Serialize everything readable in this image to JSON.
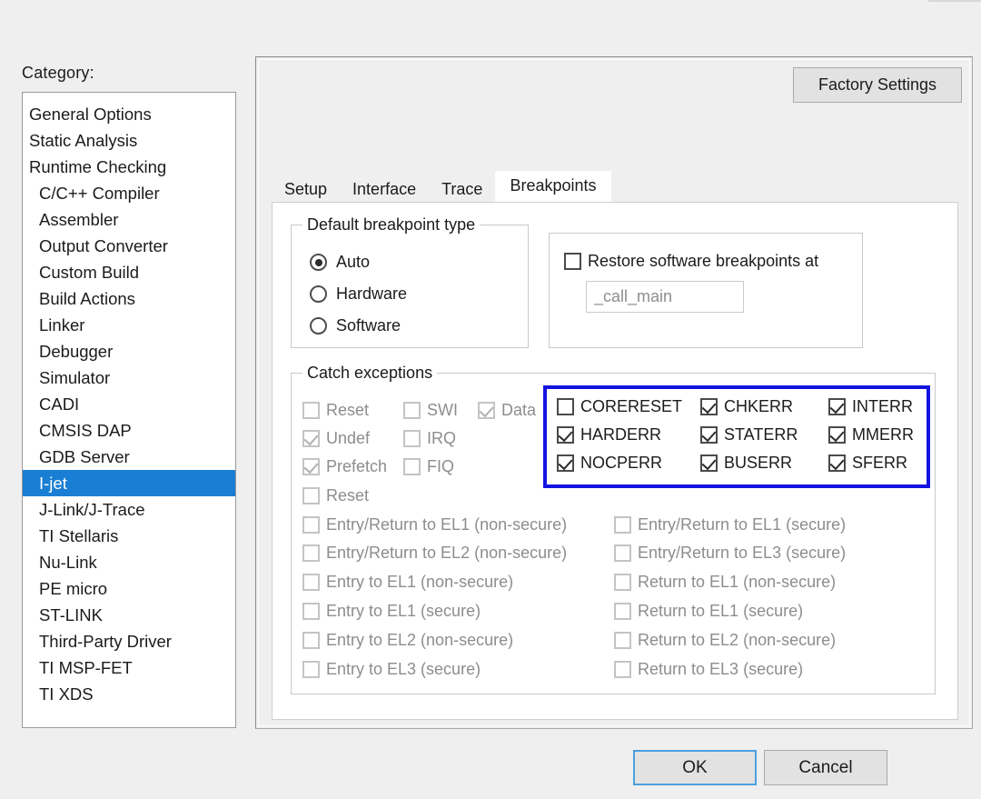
{
  "category": {
    "label": "Category:",
    "items": [
      {
        "label": "General Options",
        "indent": false,
        "selected": false
      },
      {
        "label": "Static Analysis",
        "indent": false,
        "selected": false
      },
      {
        "label": "Runtime Checking",
        "indent": false,
        "selected": false
      },
      {
        "label": "C/C++ Compiler",
        "indent": true,
        "selected": false
      },
      {
        "label": "Assembler",
        "indent": true,
        "selected": false
      },
      {
        "label": "Output Converter",
        "indent": true,
        "selected": false
      },
      {
        "label": "Custom Build",
        "indent": true,
        "selected": false
      },
      {
        "label": "Build Actions",
        "indent": true,
        "selected": false
      },
      {
        "label": "Linker",
        "indent": true,
        "selected": false
      },
      {
        "label": "Debugger",
        "indent": true,
        "selected": false
      },
      {
        "label": "Simulator",
        "indent": true,
        "selected": false
      },
      {
        "label": "CADI",
        "indent": true,
        "selected": false
      },
      {
        "label": "CMSIS DAP",
        "indent": true,
        "selected": false
      },
      {
        "label": "GDB Server",
        "indent": true,
        "selected": false
      },
      {
        "label": "I-jet",
        "indent": true,
        "selected": true
      },
      {
        "label": "J-Link/J-Trace",
        "indent": true,
        "selected": false
      },
      {
        "label": "TI Stellaris",
        "indent": true,
        "selected": false
      },
      {
        "label": "Nu-Link",
        "indent": true,
        "selected": false
      },
      {
        "label": "PE micro",
        "indent": true,
        "selected": false
      },
      {
        "label": "ST-LINK",
        "indent": true,
        "selected": false
      },
      {
        "label": "Third-Party Driver",
        "indent": true,
        "selected": false
      },
      {
        "label": "TI MSP-FET",
        "indent": true,
        "selected": false
      },
      {
        "label": "TI XDS",
        "indent": true,
        "selected": false
      }
    ]
  },
  "factory_settings_label": "Factory Settings",
  "tabs": [
    {
      "label": "Setup",
      "selected": false
    },
    {
      "label": "Interface",
      "selected": false
    },
    {
      "label": "Trace",
      "selected": false
    },
    {
      "label": "Breakpoints",
      "selected": true
    }
  ],
  "default_breakpoint_type": {
    "title": "Default breakpoint type",
    "options": [
      {
        "label": "Auto",
        "checked": true
      },
      {
        "label": "Hardware",
        "checked": false
      },
      {
        "label": "Software",
        "checked": false
      }
    ]
  },
  "restore": {
    "checkbox_label": "Restore software breakpoints at",
    "checked": false,
    "input_value": "_call_main",
    "input_placeholder": "_call_main"
  },
  "catch_exceptions": {
    "title": "Catch exceptions",
    "col1": [
      {
        "label": "Reset",
        "checked": false,
        "disabled": true
      },
      {
        "label": "Undef",
        "checked": true,
        "disabled": true
      },
      {
        "label": "Prefetch",
        "checked": true,
        "disabled": true
      }
    ],
    "col2": [
      {
        "label": "SWI",
        "checked": false,
        "disabled": true
      },
      {
        "label": "IRQ",
        "checked": false,
        "disabled": true
      },
      {
        "label": "FIQ",
        "checked": false,
        "disabled": true
      }
    ],
    "col3": [
      {
        "label": "Data",
        "checked": true,
        "disabled": true
      }
    ],
    "highlighted": {
      "border_color": "#1414E0",
      "rows": [
        [
          {
            "label": "CORERESET",
            "checked": false,
            "disabled": false
          },
          {
            "label": "CHKERR",
            "checked": true,
            "disabled": false
          },
          {
            "label": "INTERR",
            "checked": true,
            "disabled": false
          }
        ],
        [
          {
            "label": "HARDERR",
            "checked": true,
            "disabled": false
          },
          {
            "label": "STATERR",
            "checked": true,
            "disabled": false
          },
          {
            "label": "MMERR",
            "checked": true,
            "disabled": false
          }
        ],
        [
          {
            "label": "NOCPERR",
            "checked": true,
            "disabled": false
          },
          {
            "label": "BUSERR",
            "checked": true,
            "disabled": false
          },
          {
            "label": "SFERR",
            "checked": true,
            "disabled": false
          }
        ]
      ]
    },
    "reset_row": {
      "label": "Reset",
      "checked": false,
      "disabled": true
    },
    "el_left": [
      {
        "label": "Entry/Return to EL1 (non-secure)",
        "checked": false,
        "disabled": true
      },
      {
        "label": "Entry/Return to EL2 (non-secure)",
        "checked": false,
        "disabled": true
      },
      {
        "label": "Entry to EL1 (non-secure)",
        "checked": false,
        "disabled": true
      },
      {
        "label": "Entry to EL1 (secure)",
        "checked": false,
        "disabled": true
      },
      {
        "label": "Entry to EL2 (non-secure)",
        "checked": false,
        "disabled": true
      },
      {
        "label": "Entry to EL3 (secure)",
        "checked": false,
        "disabled": true
      }
    ],
    "el_right": [
      {
        "label": "Entry/Return to EL1 (secure)",
        "checked": false,
        "disabled": true
      },
      {
        "label": "Entry/Return to EL3 (secure)",
        "checked": false,
        "disabled": true
      },
      {
        "label": "Return to EL1 (non-secure)",
        "checked": false,
        "disabled": true
      },
      {
        "label": "Return to EL1 (secure)",
        "checked": false,
        "disabled": true
      },
      {
        "label": "Return to EL2 (non-secure)",
        "checked": false,
        "disabled": true
      },
      {
        "label": "Return to EL3 (secure)",
        "checked": false,
        "disabled": true
      }
    ]
  },
  "footer": {
    "ok_label": "OK",
    "cancel_label": "Cancel"
  }
}
